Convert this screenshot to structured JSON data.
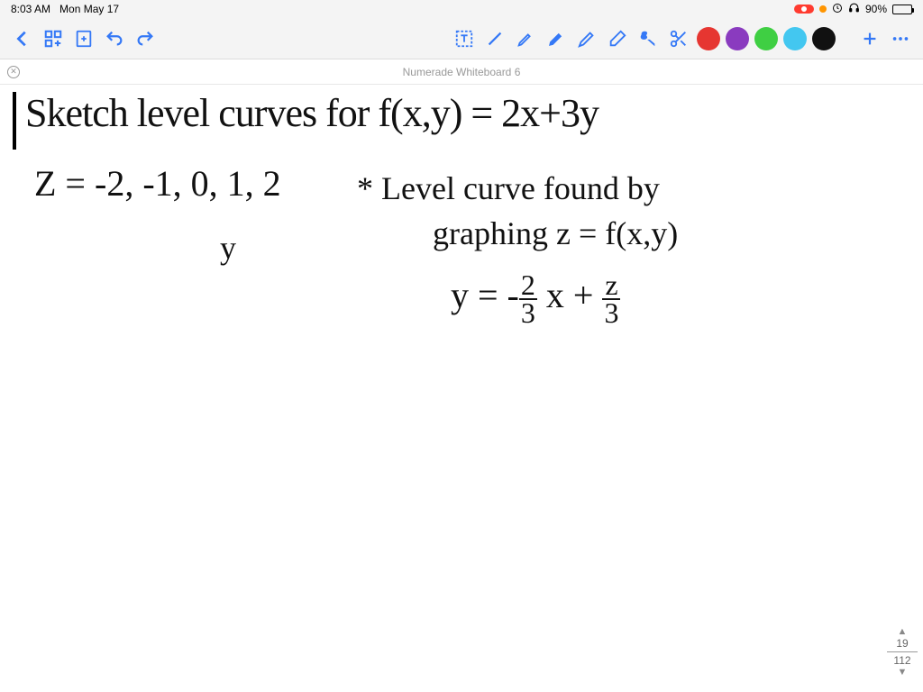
{
  "status": {
    "time": "8:03 AM",
    "date": "Mon May 17",
    "battery_pct": "90%"
  },
  "toolbar": {
    "colors": [
      "#e63631",
      "#8a3bbf",
      "#3fcf43",
      "#43c7f0",
      "#111111"
    ]
  },
  "titlebar": {
    "title": "Numerade Whiteboard 6"
  },
  "pager": {
    "current": "19",
    "total": "112"
  },
  "hand": {
    "l1": "Sketch level curves for f(x,y) = 2x+3y",
    "l2": "Z = -2, -1, 0, 1, 2",
    "l3": "* Level curve found by",
    "l4a": "graphing",
    "l4b": "z = f(x,y)",
    "l5a": "y = -",
    "l5b_num": "2",
    "l5b_den": "3",
    "l5c": " x + ",
    "l5d_num": "z",
    "l5d_den": "3",
    "y_label": "y"
  }
}
